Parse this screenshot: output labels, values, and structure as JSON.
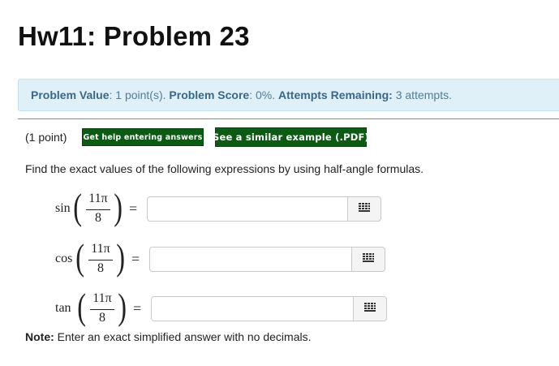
{
  "page": {
    "title": "Hw11: Problem 23"
  },
  "info": {
    "value_label": "Problem Value",
    "value_text": ": 1 point(s).",
    "score_label": "Problem Score",
    "score_text": ": 0%.",
    "attempts_label": "Attempts Remaining:",
    "attempts_text": " 3 attempts."
  },
  "problem": {
    "points": "(1 point)",
    "help_button": "Get help entering answers",
    "example_button": "See a similar example (.PDF)",
    "instruction": "Find the exact values of the following expressions by using half-angle formulas.",
    "expressions": [
      {
        "fn": "sin",
        "numerator": "11π",
        "denominator": "8",
        "equals": "=",
        "answer": ""
      },
      {
        "fn": "cos",
        "numerator": "11π",
        "denominator": "8",
        "equals": "=",
        "answer": ""
      },
      {
        "fn": "tan",
        "numerator": "11π",
        "denominator": "8",
        "equals": "=",
        "answer": ""
      }
    ],
    "note_label": "Note:",
    "note_text": " Enter an exact simplified answer with no decimals."
  },
  "icons": {
    "palette": "grid-icon"
  },
  "colors": {
    "info_bg": "#dff0f8",
    "info_text": "#38678a",
    "button_bg": "#0d5a14"
  }
}
